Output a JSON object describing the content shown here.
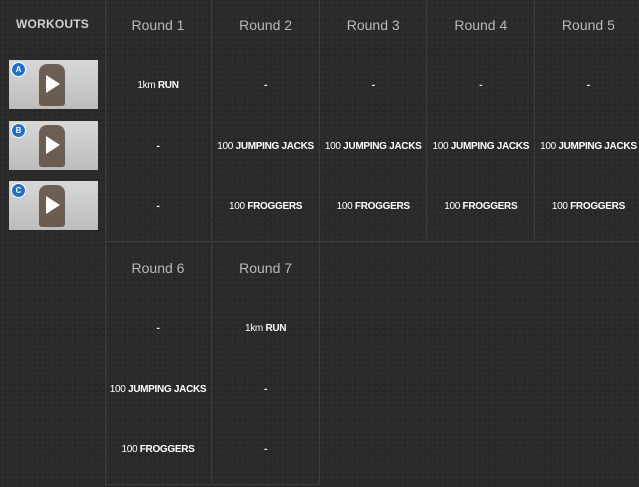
{
  "sidebar": {
    "title": "WORKOUTS",
    "videos": [
      {
        "badge": "A"
      },
      {
        "badge": "B"
      },
      {
        "badge": "C"
      }
    ]
  },
  "rounds": [
    {
      "title": "Round 1",
      "exercises": [
        {
          "qty": "1km",
          "name": "RUN"
        },
        {
          "qty": "",
          "name": "-"
        },
        {
          "qty": "",
          "name": "-"
        }
      ]
    },
    {
      "title": "Round 2",
      "exercises": [
        {
          "qty": "",
          "name": "-"
        },
        {
          "qty": "100",
          "name": "JUMPING JACKS"
        },
        {
          "qty": "100",
          "name": "FROGGERS"
        }
      ]
    },
    {
      "title": "Round 3",
      "exercises": [
        {
          "qty": "",
          "name": "-"
        },
        {
          "qty": "100",
          "name": "JUMPING JACKS"
        },
        {
          "qty": "100",
          "name": "FROGGERS"
        }
      ]
    },
    {
      "title": "Round 4",
      "exercises": [
        {
          "qty": "",
          "name": "-"
        },
        {
          "qty": "100",
          "name": "JUMPING JACKS"
        },
        {
          "qty": "100",
          "name": "FROGGERS"
        }
      ]
    },
    {
      "title": "Round 5",
      "exercises": [
        {
          "qty": "",
          "name": "-"
        },
        {
          "qty": "100",
          "name": "JUMPING JACKS"
        },
        {
          "qty": "100",
          "name": "FROGGERS"
        }
      ]
    },
    {
      "title": "Round 6",
      "exercises": [
        {
          "qty": "",
          "name": "-"
        },
        {
          "qty": "100",
          "name": "JUMPING JACKS"
        },
        {
          "qty": "100",
          "name": "FROGGERS"
        }
      ]
    },
    {
      "title": "Round 7",
      "exercises": [
        {
          "qty": "1km",
          "name": "RUN"
        },
        {
          "qty": "",
          "name": "-"
        },
        {
          "qty": "",
          "name": "-"
        }
      ]
    }
  ]
}
